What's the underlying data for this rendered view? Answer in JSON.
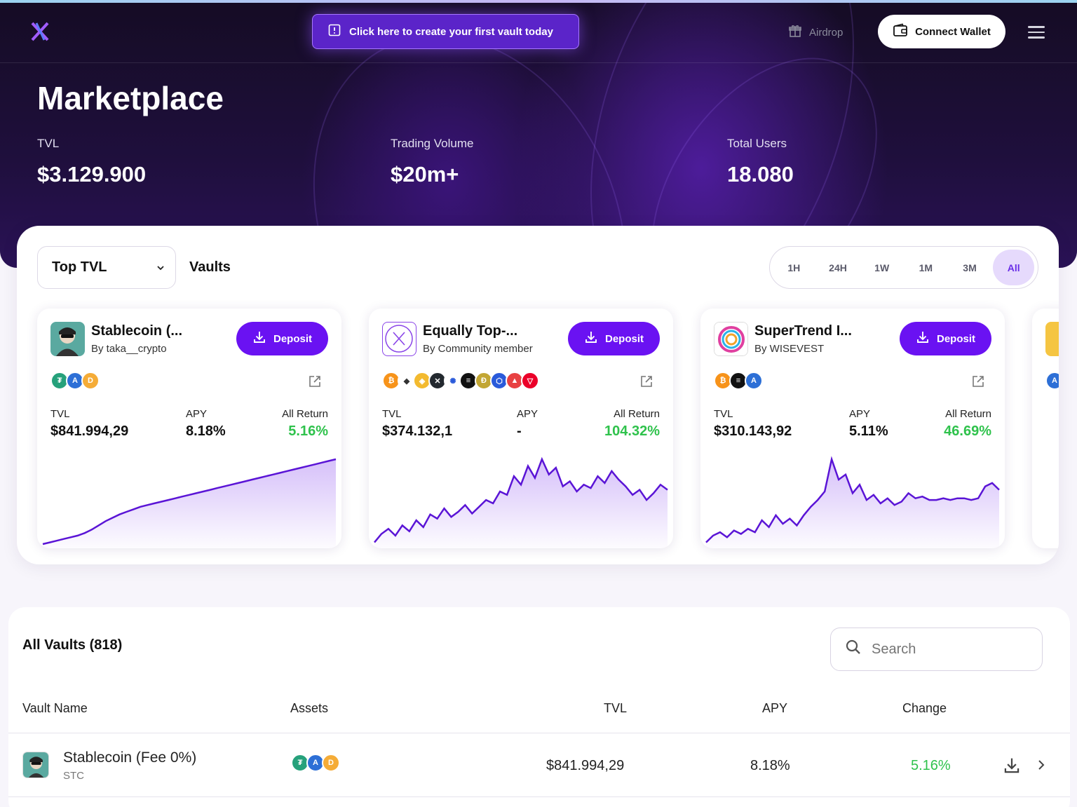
{
  "nav": {
    "promo": "Click here to create your first vault today",
    "airdrop": "Airdrop",
    "connect": "Connect Wallet"
  },
  "hero": {
    "title": "Marketplace",
    "stats": [
      {
        "label": "TVL",
        "value": "$3.129.900"
      },
      {
        "label": "Trading Volume",
        "value": "$20m+"
      },
      {
        "label": "Total Users",
        "value": "18.080"
      }
    ]
  },
  "filters": {
    "sort": "Top TVL",
    "section": "Vaults",
    "ranges": [
      "1H",
      "24H",
      "1W",
      "1M",
      "3M",
      "All"
    ],
    "active_range": "All"
  },
  "cards": [
    {
      "name": "Stablecoin (...",
      "by": "By taka__crypto",
      "deposit": "Deposit",
      "assets": [
        "usdt",
        "aave",
        "dai"
      ],
      "tvl_label": "TVL",
      "tvl": "$841.994,29",
      "apy_label": "APY",
      "apy": "8.18%",
      "ret_label": "All Return",
      "ret": "5.16%",
      "series": [
        0,
        2,
        4,
        6,
        8,
        10,
        13,
        17,
        22,
        27,
        31,
        35,
        38,
        41,
        44,
        46,
        48,
        50,
        52,
        54,
        56,
        58,
        60,
        62,
        64,
        66,
        68,
        70,
        72,
        74,
        76,
        78,
        80,
        82,
        84,
        86,
        88,
        90,
        92,
        94,
        96,
        98,
        100
      ]
    },
    {
      "name": "Equally Top-...",
      "by": "By Community member",
      "deposit": "Deposit",
      "assets": [
        "btc",
        "eth",
        "bnb",
        "xrp",
        "ada",
        "sol",
        "doge",
        "link",
        "avax",
        "trx"
      ],
      "tvl_label": "TVL",
      "tvl": "$374.132,1",
      "apy_label": "APY",
      "apy": "-",
      "ret_label": "All Return",
      "ret": "104.32%",
      "series": [
        2,
        12,
        18,
        10,
        22,
        15,
        28,
        20,
        35,
        30,
        42,
        32,
        38,
        46,
        36,
        44,
        52,
        48,
        62,
        58,
        80,
        70,
        92,
        78,
        100,
        82,
        90,
        68,
        74,
        62,
        70,
        66,
        80,
        72,
        86,
        76,
        68,
        58,
        64,
        52,
        60,
        70,
        64
      ]
    },
    {
      "name": "SuperTrend I...",
      "by": "By WISEVEST",
      "deposit": "Deposit",
      "assets": [
        "btc",
        "usdc",
        "sol"
      ],
      "tvl_label": "TVL",
      "tvl": "$310.143,92",
      "apy_label": "APY",
      "apy": "5.11%",
      "ret_label": "All Return",
      "ret": "46.69%",
      "series": [
        2,
        10,
        14,
        8,
        16,
        12,
        18,
        14,
        28,
        20,
        34,
        24,
        30,
        22,
        34,
        44,
        52,
        62,
        100,
        76,
        82,
        60,
        70,
        52,
        58,
        48,
        54,
        46,
        50,
        60,
        54,
        56,
        52,
        52,
        54,
        52,
        54,
        54,
        52,
        54,
        68,
        72,
        64
      ]
    }
  ],
  "list": {
    "title": "All Vaults (818)",
    "search_placeholder": "Search",
    "headers": {
      "name": "Vault Name",
      "assets": "Assets",
      "tvl": "TVL",
      "apy": "APY",
      "change": "Change"
    },
    "rows": [
      {
        "name": "Stablecoin (Fee 0%)",
        "symbol": "STC",
        "assets": [
          "usdt",
          "aave",
          "dai"
        ],
        "tvl": "$841.994,29",
        "apy": "8.18%",
        "change": "5.16%"
      }
    ]
  },
  "colors": {
    "accent": "#6a12f2",
    "positive": "#2fc24c",
    "hero_dark": "#150c24"
  }
}
